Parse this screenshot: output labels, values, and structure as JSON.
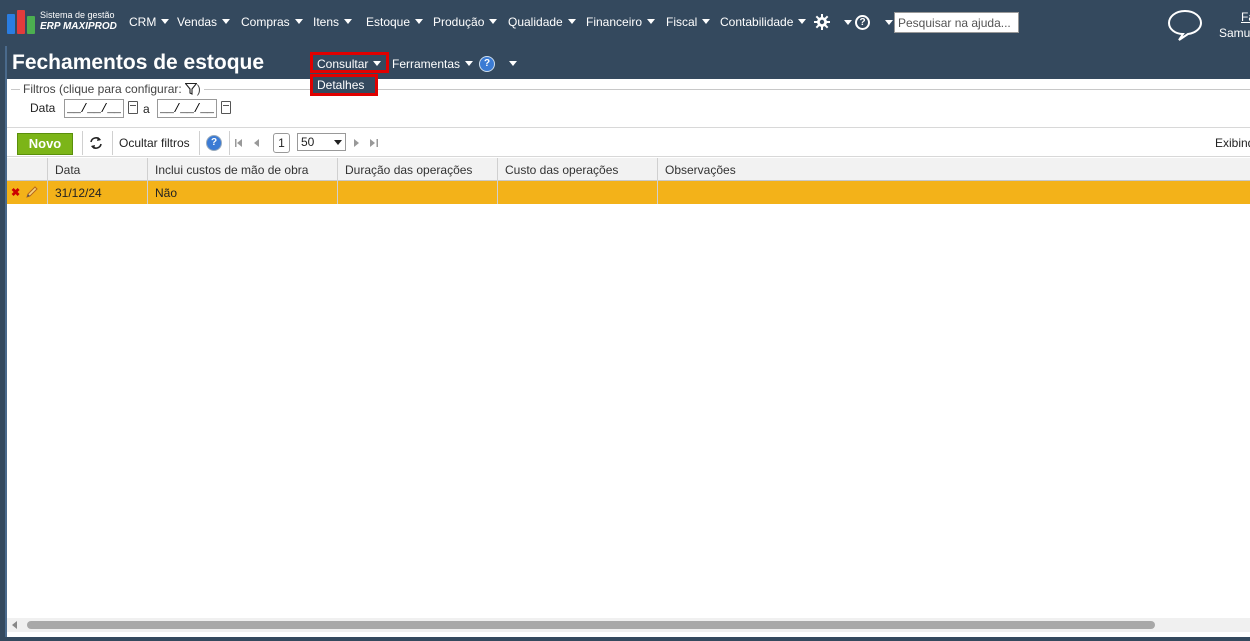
{
  "logo": {
    "line1": "Sistema de gestão",
    "line2": "ERP MAXIPROD"
  },
  "nav": {
    "items": [
      {
        "label": "CRM"
      },
      {
        "label": "Vendas"
      },
      {
        "label": "Compras"
      },
      {
        "label": "Itens"
      },
      {
        "label": "Estoque"
      },
      {
        "label": "Produção"
      },
      {
        "label": "Qualidade"
      },
      {
        "label": "Financeiro"
      },
      {
        "label": "Fiscal"
      },
      {
        "label": "Contabilidade"
      }
    ],
    "search_placeholder": "Pesquisar na ajuda...",
    "user_link": "Fa",
    "user_name": "Samu"
  },
  "page": {
    "title": "Fechamentos de estoque",
    "consultar_label": "Consultar",
    "ferramentas_label": "Ferramentas",
    "dropdown_item": "Detalhes"
  },
  "filters": {
    "legend": "Filtros (clique para configurar:",
    "legend_close": ")",
    "date_label": "Data",
    "date_from": "__/__/__",
    "date_to": "__/__/__",
    "to_label": "a"
  },
  "toolbar": {
    "new_label": "Novo",
    "hide_filters_label": "Ocultar filtros",
    "page_number": "1",
    "page_size": "50",
    "exibindo": "Exibind"
  },
  "grid": {
    "columns": [
      "Data",
      "Inclui custos de mão de obra",
      "Duração das operações",
      "Custo das operações",
      "Observações"
    ],
    "rows": [
      {
        "data": "31/12/24",
        "inclui": "Não",
        "duracao": "",
        "custo": "",
        "observacoes": ""
      }
    ]
  },
  "colors": {
    "header_bg": "#34495e",
    "selected_row": "#f3b219",
    "new_button": "#7cb518",
    "highlight_border": "#e00000"
  }
}
